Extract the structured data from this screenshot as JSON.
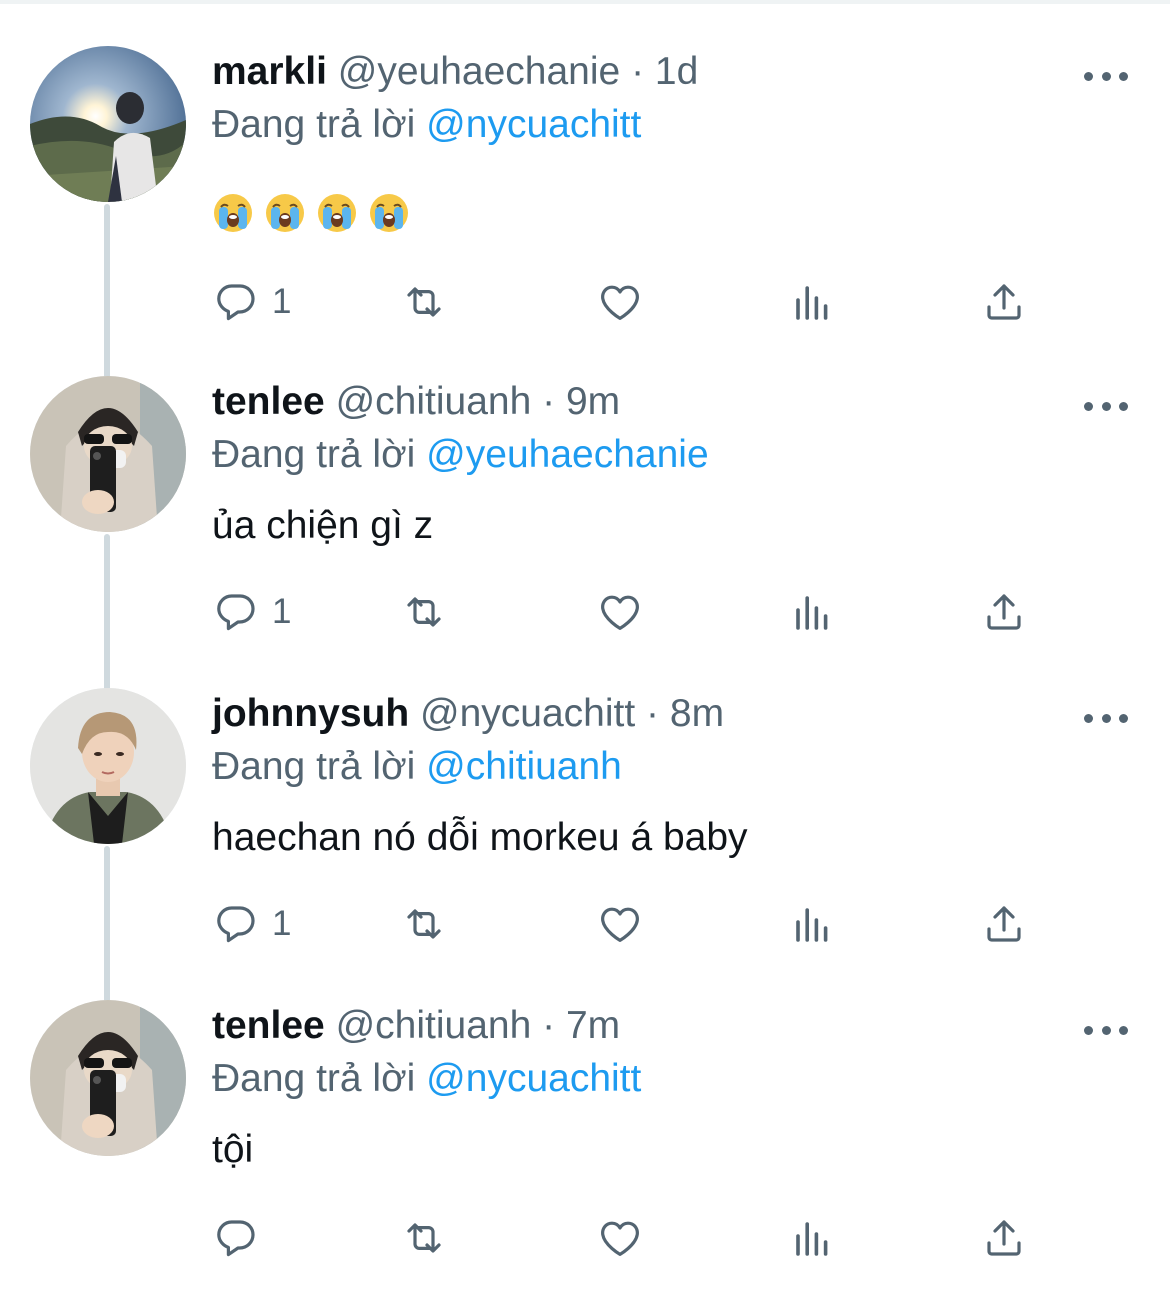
{
  "colors": {
    "text_primary": "#0f1419",
    "text_secondary": "#536471",
    "accent": "#1d9bf0",
    "thread_line": "#cfd9de"
  },
  "tweets": [
    {
      "display_name": "markli",
      "handle": "@yeuhaechanie",
      "separator": "·",
      "time": "1d",
      "replying_prefix": "Đang trả lời",
      "replying_to": "@nycuachitt",
      "text": "",
      "emojis": [
        "loudly-crying-face",
        "loudly-crying-face",
        "loudly-crying-face",
        "loudly-crying-face"
      ],
      "reply_count": "1",
      "avatar": "sunset-silhouette"
    },
    {
      "display_name": "tenlee",
      "handle": "@chitiuanh",
      "separator": "·",
      "time": "9m",
      "replying_prefix": "Đang trả lời",
      "replying_to": "@yeuhaechanie",
      "text": "ủa chiện gì z",
      "reply_count": "1",
      "avatar": "mirror-selfie"
    },
    {
      "display_name": "johnnysuh",
      "handle": "@nycuachitt",
      "separator": "·",
      "time": "8m",
      "replying_prefix": "Đang trả lời",
      "replying_to": "@chitiuanh",
      "text": "haechan nó dỗi morkeu á baby",
      "reply_count": "1",
      "avatar": "portrait"
    },
    {
      "display_name": "tenlee",
      "handle": "@chitiuanh",
      "separator": "·",
      "time": "7m",
      "replying_prefix": "Đang trả lời",
      "replying_to": "@nycuachitt",
      "text": "tội",
      "reply_count": "",
      "avatar": "mirror-selfie"
    }
  ],
  "icons": {
    "reply": "speech-bubble-icon",
    "retweet": "retweet-arrows-icon",
    "like": "heart-outline-icon",
    "views": "bar-chart-icon",
    "share": "share-upload-icon",
    "more": "more-dots-icon"
  }
}
